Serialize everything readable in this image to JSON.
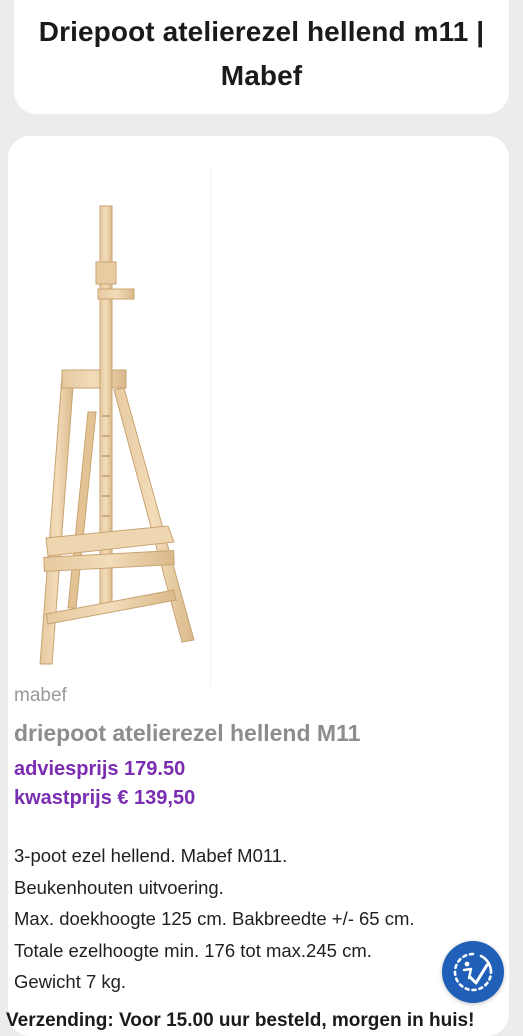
{
  "page": {
    "title_line1": "Driepoot atelierezel hellend m11 |",
    "title_line2": "Mabef"
  },
  "product": {
    "brand": "mabef",
    "name": "driepoot atelierezel hellend M11",
    "price_advies": "adviesprijs 179.50",
    "price_kwast": "kwastprijs € 139,50",
    "description_lines": [
      "3-poot ezel hellend. Mabef M011.",
      "Beukenhouten uitvoering.",
      "Max. doekhoogte 125 cm. Bakbreedte +/- 65 cm.",
      "Totale ezelhoogte min. 176 tot max.245 cm.",
      "Gewicht 7 kg."
    ],
    "footer_partial": "Verzending: Voor 15.00 uur besteld, morgen in huis!"
  },
  "colors": {
    "accent_purple": "#7a2db0",
    "accessibility_blue": "#1f5fb8"
  },
  "icons": {
    "accessibility": "accessibility-check-icon"
  }
}
